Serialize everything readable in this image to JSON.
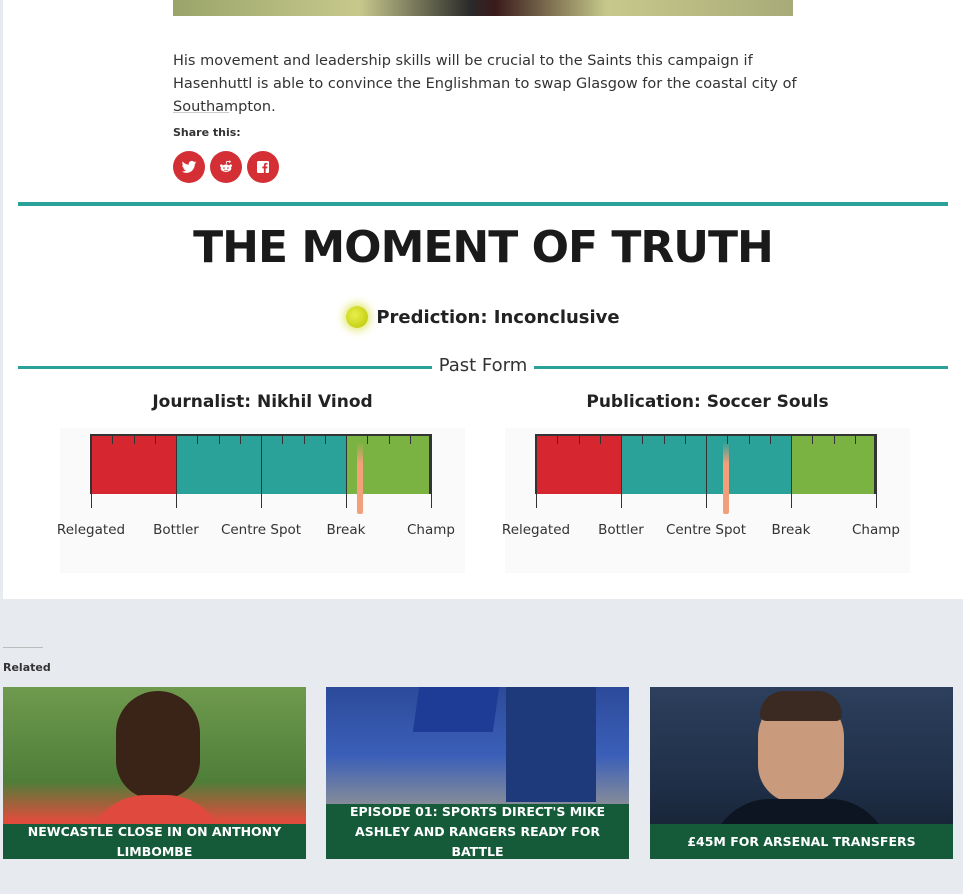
{
  "article": {
    "paragraph": "His movement and leadership skills will be crucial to the Saints this campaign if Hasenhuttl is able to convince the Englishman to swap Glasgow for the coastal city of Southampton.",
    "share_label": "Share this:",
    "share_buttons": [
      {
        "icon": "twitter-icon"
      },
      {
        "icon": "reddit-icon"
      },
      {
        "icon": "facebook-icon"
      }
    ],
    "accent_color": "#d32f35"
  },
  "verdict": {
    "title": "THE MOMENT OF TRUTH",
    "prediction": "Prediction: Inconclusive",
    "past_form_label": "Past Form",
    "accent_color": "#2aa29a"
  },
  "gauges": [
    {
      "title": "Journalist: Nikhil Vinod",
      "labels": [
        "Relegated",
        "Bottler",
        "Centre Spot",
        "Break",
        "Champ"
      ],
      "needle_position": 0.79
    },
    {
      "title": "Publication: Soccer Souls",
      "labels": [
        "Relegated",
        "Bottler",
        "Centre Spot",
        "Break",
        "Champ"
      ],
      "needle_position": 0.56
    }
  ],
  "gauge_colors": [
    "#d6262f",
    "#2aa29a",
    "#2aa29a",
    "#7ab342"
  ],
  "related": {
    "label": "Related",
    "cards": [
      {
        "caption": "NEWCASTLE CLOSE IN ON ANTHONY LIMBOMBE"
      },
      {
        "caption": "EPISODE 01: SPORTS DIRECT'S MIKE ASHLEY AND RANGERS READY FOR BATTLE"
      },
      {
        "caption": "£45M FOR ARSENAL TRANSFERS"
      }
    ],
    "caption_color": "#155b3a"
  }
}
